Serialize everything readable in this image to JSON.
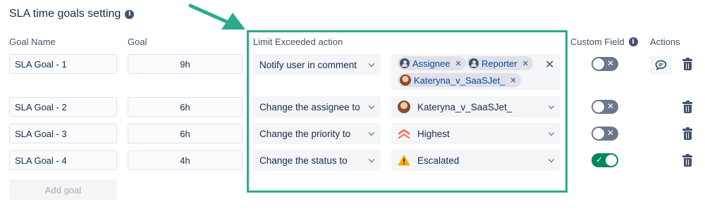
{
  "title": "SLA time goals setting",
  "headers": {
    "goal_name": "Goal Name",
    "goal": "Goal",
    "limit_action": "Limit Exceeded action",
    "custom_field": "Custom Field",
    "actions": "Actions"
  },
  "rows": [
    {
      "name": "SLA Goal - 1",
      "goal": "9h",
      "action": "Notify user in comment",
      "custom_field_enabled": false,
      "recipients": [
        "Assignee",
        "Reporter",
        "Kateryna_v_SaaSJet_"
      ]
    },
    {
      "name": "SLA Goal - 2",
      "goal": "6h",
      "action": "Change the assignee to",
      "value": "Kateryna_v_SaaSJet_",
      "value_icon": "user-avatar-icon",
      "custom_field_enabled": false
    },
    {
      "name": "SLA Goal - 3",
      "goal": "6h",
      "action": "Change the priority to",
      "value": "Highest",
      "value_icon": "priority-highest-icon",
      "custom_field_enabled": false
    },
    {
      "name": "SLA Goal - 4",
      "goal": "4h",
      "action": "Change the status to",
      "value": "Escalated",
      "value_icon": "warning-icon",
      "custom_field_enabled": true
    }
  ],
  "add_goal_label": "Add goal",
  "colors": {
    "highlight": "#2bab8b",
    "toggle_on": "#00875a",
    "toggle_off": "#6b778c",
    "priority_highest": "#ff5630",
    "warning": "#ffab00"
  }
}
